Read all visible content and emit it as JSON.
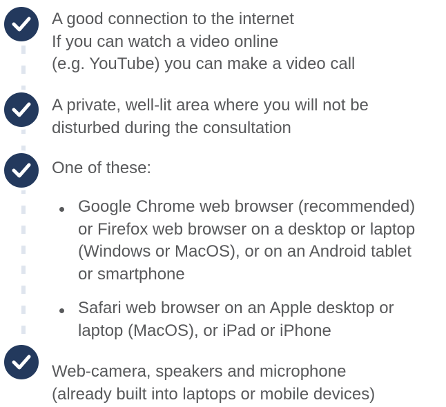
{
  "colors": {
    "check_fill": "#23395d",
    "text": "#58595b",
    "dash": "#dfe5ee"
  },
  "items": [
    {
      "icon": "checkmark-circle-icon",
      "lines": [
        "A good connection to the  internet",
        "If you can watch a video online",
        "(e.g. YouTube) you can make a video call"
      ]
    },
    {
      "icon": "checkmark-circle-icon",
      "lines": [
        "A private, well-lit area where you will not be",
        "disturbed during the consultation"
      ]
    },
    {
      "icon": "checkmark-circle-icon",
      "lines": [
        "One of these:"
      ],
      "subitems": [
        {
          "lines": [
            "Google Chrome web browser (recommended)",
            "or Firefox web browser on a desktop or laptop",
            "(Windows or MacOS), or on an Android tablet",
            "or smartphone"
          ]
        },
        {
          "lines": [
            "Safari web browser on an Apple desktop or",
            "laptop (MacOS), or iPad or iPhone"
          ]
        }
      ]
    },
    {
      "icon": "checkmark-circle-icon",
      "lines": [
        "Web-camera, speakers and microphone",
        "(already built into laptops or mobile devices)"
      ]
    }
  ]
}
